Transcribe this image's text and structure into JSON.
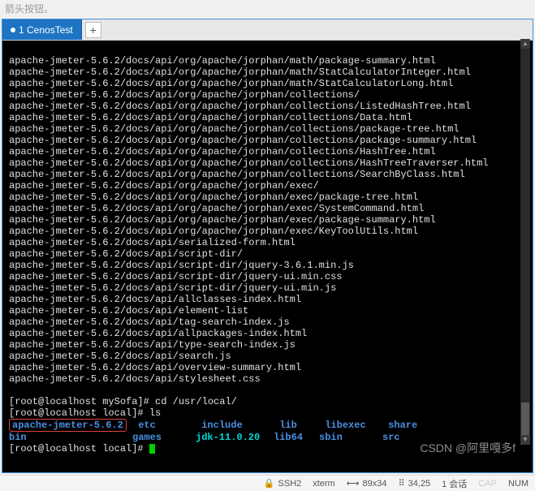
{
  "top_hint": "箭头按钮。",
  "tab": {
    "label": "1 CenosTest"
  },
  "addTab": "+",
  "terminal": {
    "lines": [
      "apache-jmeter-5.6.2/docs/api/org/apache/jorphan/math/package-summary.html",
      "apache-jmeter-5.6.2/docs/api/org/apache/jorphan/math/StatCalculatorInteger.html",
      "apache-jmeter-5.6.2/docs/api/org/apache/jorphan/math/StatCalculatorLong.html",
      "apache-jmeter-5.6.2/docs/api/org/apache/jorphan/collections/",
      "apache-jmeter-5.6.2/docs/api/org/apache/jorphan/collections/ListedHashTree.html",
      "apache-jmeter-5.6.2/docs/api/org/apache/jorphan/collections/Data.html",
      "apache-jmeter-5.6.2/docs/api/org/apache/jorphan/collections/package-tree.html",
      "apache-jmeter-5.6.2/docs/api/org/apache/jorphan/collections/package-summary.html",
      "apache-jmeter-5.6.2/docs/api/org/apache/jorphan/collections/HashTree.html",
      "apache-jmeter-5.6.2/docs/api/org/apache/jorphan/collections/HashTreeTraverser.html",
      "apache-jmeter-5.6.2/docs/api/org/apache/jorphan/collections/SearchByClass.html",
      "apache-jmeter-5.6.2/docs/api/org/apache/jorphan/exec/",
      "apache-jmeter-5.6.2/docs/api/org/apache/jorphan/exec/package-tree.html",
      "apache-jmeter-5.6.2/docs/api/org/apache/jorphan/exec/SystemCommand.html",
      "apache-jmeter-5.6.2/docs/api/org/apache/jorphan/exec/package-summary.html",
      "apache-jmeter-5.6.2/docs/api/org/apache/jorphan/exec/KeyToolUtils.html",
      "apache-jmeter-5.6.2/docs/api/serialized-form.html",
      "apache-jmeter-5.6.2/docs/api/script-dir/",
      "apache-jmeter-5.6.2/docs/api/script-dir/jquery-3.6.1.min.js",
      "apache-jmeter-5.6.2/docs/api/script-dir/jquery-ui.min.css",
      "apache-jmeter-5.6.2/docs/api/script-dir/jquery-ui.min.js",
      "apache-jmeter-5.6.2/docs/api/allclasses-index.html",
      "apache-jmeter-5.6.2/docs/api/element-list",
      "apache-jmeter-5.6.2/docs/api/tag-search-index.js",
      "apache-jmeter-5.6.2/docs/api/allpackages-index.html",
      "apache-jmeter-5.6.2/docs/api/type-search-index.js",
      "apache-jmeter-5.6.2/docs/api/search.js",
      "apache-jmeter-5.6.2/docs/api/overview-summary.html",
      "apache-jmeter-5.6.2/docs/api/stylesheet.css"
    ],
    "prompt1": {
      "user": "[root@localhost mySofa]#",
      "cmd": "cd /usr/local/"
    },
    "prompt2": {
      "user": "[root@localhost local]#",
      "cmd": "ls"
    },
    "ls": {
      "row1": [
        "apache-jmeter-5.6.2",
        "etc",
        "include",
        "lib",
        "libexec",
        "share"
      ],
      "row2": [
        "bin",
        "games",
        "jdk-11.0.20",
        "lib64",
        "sbin",
        "src"
      ]
    },
    "prompt3": {
      "user": "[root@localhost local]#",
      "cmd": ""
    }
  },
  "status": {
    "ssh": "SSH2",
    "term": "xterm",
    "dim": "89x34",
    "pos": "34,25",
    "sess": "1 会话",
    "cap": "CAP",
    "num": "NUM"
  },
  "watermark": "CSDN @阿里嘎多f"
}
